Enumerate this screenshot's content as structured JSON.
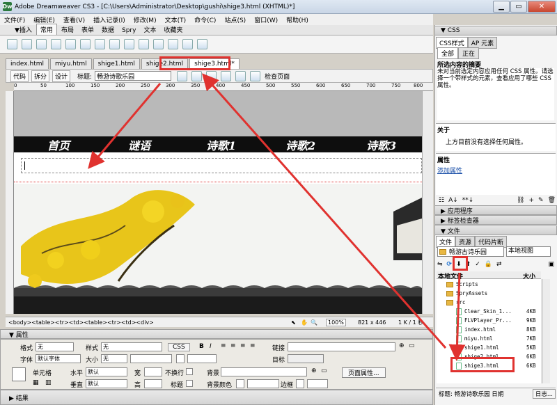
{
  "window": {
    "title": "Adobe Dreamweaver CS3 - [C:\\Users\\Administrator\\Desktop\\gushi\\shige3.html (XHTML)*]",
    "app_icon": "Dw"
  },
  "menu": [
    "文件(F)",
    "编辑(E)",
    "查看(V)",
    "插入记录(I)",
    "修改(M)",
    "文本(T)",
    "命令(C)",
    "站点(S)",
    "窗口(W)",
    "帮助(H)"
  ],
  "insert_tabs": [
    "▼插入",
    "常用",
    "布局",
    "表单",
    "数据",
    "Spry",
    "文本",
    "收藏夹"
  ],
  "doc_tabs": [
    "index.html",
    "miyu.html",
    "shige1.html",
    "shige2.html",
    "shige3.html*"
  ],
  "doc_toolbar": {
    "code": "代码",
    "split": "拆分",
    "design": "设计",
    "title_label": "标题:",
    "title_value": "畅游诗歌乐园",
    "check_page": "检查页面"
  },
  "ruler_marks": [
    "0",
    "50",
    "100",
    "150",
    "200",
    "250",
    "300",
    "350",
    "400",
    "450",
    "500",
    "550",
    "600",
    "650",
    "700",
    "750",
    "800"
  ],
  "page_nav": [
    "首页",
    "谜语",
    "诗歌1",
    "诗歌2",
    "诗歌3"
  ],
  "status": {
    "path": "<body><table><tr><td><table><tr><td><div>",
    "zoom": "100%",
    "size": "821 x 446",
    "weight": "1 K / 1 秒"
  },
  "properties": {
    "title": "▼ 属性",
    "format_label": "格式",
    "format_value": "无",
    "style_label": "样式",
    "style_value": "无",
    "css_btn": "CSS",
    "bold": "B",
    "italic": "I",
    "link_label": "链接",
    "font_label": "字体",
    "font_value": "默认字体",
    "size_label": "大小",
    "size_value": "无",
    "target_label": "目标",
    "cell_label": "单元格",
    "horz_label": "水平",
    "horz_value": "默认",
    "width_label": "宽",
    "nowrap_label": "不换行",
    "bg_label": "背景",
    "page_props_btn": "页面属性...",
    "vert_label": "垂直",
    "vert_value": "默认",
    "height_label": "高",
    "header_label": "标题",
    "bgcolor_label": "背景颜色",
    "border_label": "边框"
  },
  "results_panel": "▶ 结果",
  "css_panel": {
    "title": "▼ CSS",
    "tabs": [
      "CSS样式",
      "AP 元素"
    ],
    "modes": [
      "全部",
      "正在"
    ],
    "summary_title": "所选内容的摘要",
    "summary_text": "未对当前选定内容应用任何 CSS 属性。请选择一个带样式的元素，查看应用了哪些 CSS 属性。",
    "about_title": "关于",
    "about_text": "上方目前没有选择任何属性。",
    "props_title": "属性",
    "add_prop": "添加属性"
  },
  "app_panel": "▶ 应用程序",
  "tag_panel": "▶ 标签检查器",
  "files_panel": {
    "title": "▼ 文件",
    "tabs": [
      "文件",
      "资源",
      "代码片断"
    ],
    "site": "畅游古诗乐园",
    "view": "本地视图",
    "col_local": "本地文件",
    "col_size": "大小",
    "items": [
      {
        "name": "Scripts",
        "size": "",
        "type": "folder"
      },
      {
        "name": "SpryAssets",
        "size": "",
        "type": "folder"
      },
      {
        "name": "src",
        "size": "",
        "type": "folder"
      },
      {
        "name": "Clear_Skin_1...",
        "size": "4KB",
        "type": "file"
      },
      {
        "name": "FLVPlayer_Pr...",
        "size": "9KB",
        "type": "file"
      },
      {
        "name": "index.html",
        "size": "8KB",
        "type": "file"
      },
      {
        "name": "miyu.html",
        "size": "7KB",
        "type": "file"
      },
      {
        "name": "shige1.html",
        "size": "5KB",
        "type": "file"
      },
      {
        "name": "shige2.html",
        "size": "6KB",
        "type": "file"
      },
      {
        "name": "shige3.html",
        "size": "6KB",
        "type": "file"
      }
    ],
    "status": "标题: 畅游诗歌乐园 日期",
    "log": "日志..."
  },
  "colors": {
    "highlight": "#e0322f",
    "navbar": "#0e0e0e",
    "banner": "#b9b9b9"
  }
}
